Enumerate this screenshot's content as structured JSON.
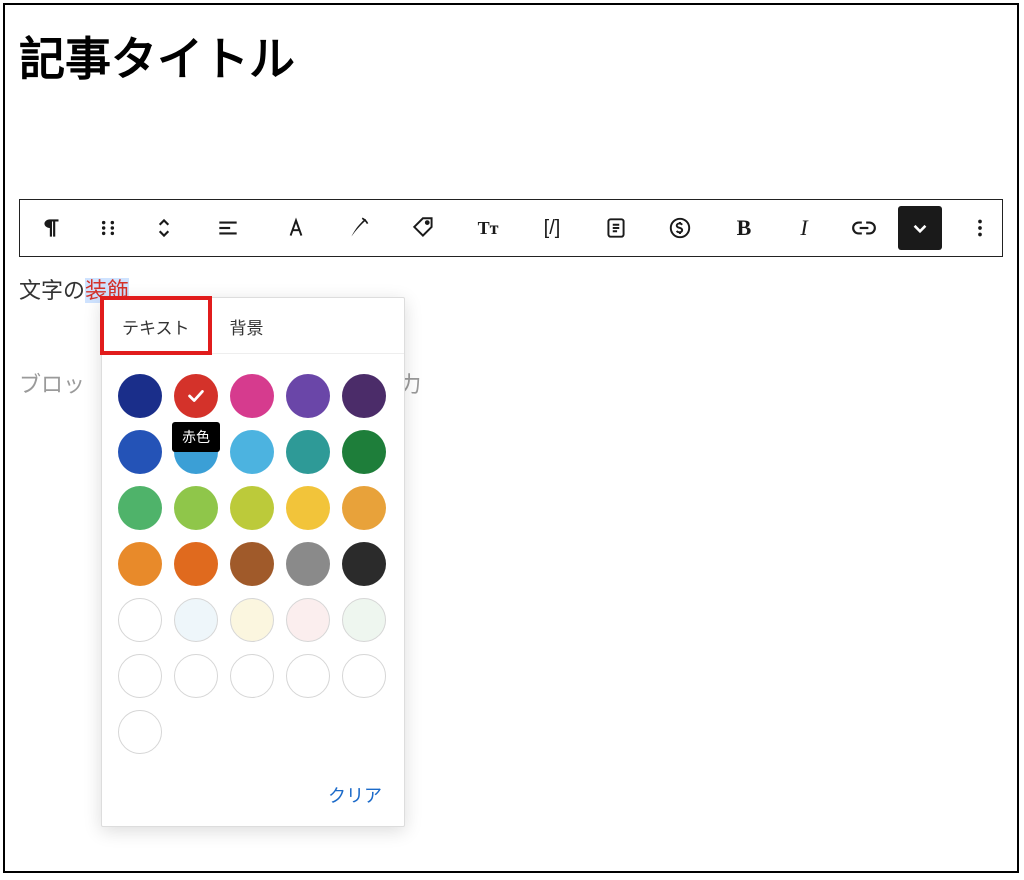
{
  "title": "記事タイトル",
  "toolbar": {
    "bold_glyph": "B",
    "italic_glyph": "I",
    "font_size_glyph": "Tт",
    "shortcode_glyph": "[/]"
  },
  "paragraph": {
    "prefix": "文字の",
    "highlighted": "装飾"
  },
  "placeholder": {
    "left_fragment": "ブロッ",
    "right_fragment": "力"
  },
  "popover": {
    "tab_text": "テキスト",
    "tab_background": "背景",
    "tooltip": "赤色",
    "clear": "クリア",
    "swatches": [
      {
        "name": "navy",
        "hex": "#1a2e8a",
        "hollow": false,
        "selected": false,
        "tooltip": false
      },
      {
        "name": "red",
        "hex": "#d4322a",
        "hollow": false,
        "selected": true,
        "tooltip": true
      },
      {
        "name": "pink",
        "hex": "#d63b8e",
        "hollow": false,
        "selected": false,
        "tooltip": false
      },
      {
        "name": "purple",
        "hex": "#6a46a8",
        "hollow": false,
        "selected": false,
        "tooltip": false
      },
      {
        "name": "dark-purple",
        "hex": "#4b2c69",
        "hollow": false,
        "selected": false,
        "tooltip": false
      },
      {
        "name": "blue",
        "hex": "#2453b7",
        "hollow": false,
        "selected": false,
        "tooltip": false
      },
      {
        "name": "sky",
        "hex": "#3b9fd6",
        "hollow": false,
        "selected": false,
        "tooltip": false
      },
      {
        "name": "light-blue",
        "hex": "#4cb3e0",
        "hollow": false,
        "selected": false,
        "tooltip": false
      },
      {
        "name": "teal",
        "hex": "#2e9a97",
        "hollow": false,
        "selected": false,
        "tooltip": false
      },
      {
        "name": "dark-green",
        "hex": "#1e7e3a",
        "hollow": false,
        "selected": false,
        "tooltip": false
      },
      {
        "name": "green",
        "hex": "#4fb36a",
        "hollow": false,
        "selected": false,
        "tooltip": false
      },
      {
        "name": "lime",
        "hex": "#8fc64a",
        "hollow": false,
        "selected": false,
        "tooltip": false
      },
      {
        "name": "yellow-green",
        "hex": "#bcca3a",
        "hollow": false,
        "selected": false,
        "tooltip": false
      },
      {
        "name": "yellow",
        "hex": "#f2c43a",
        "hollow": false,
        "selected": false,
        "tooltip": false
      },
      {
        "name": "gold",
        "hex": "#e8a23a",
        "hollow": false,
        "selected": false,
        "tooltip": false
      },
      {
        "name": "orange",
        "hex": "#e88a2a",
        "hollow": false,
        "selected": false,
        "tooltip": false
      },
      {
        "name": "dark-orange",
        "hex": "#e06a1e",
        "hollow": false,
        "selected": false,
        "tooltip": false
      },
      {
        "name": "brown",
        "hex": "#a05a2a",
        "hollow": false,
        "selected": false,
        "tooltip": false
      },
      {
        "name": "gray",
        "hex": "#8a8a8a",
        "hollow": false,
        "selected": false,
        "tooltip": false
      },
      {
        "name": "black",
        "hex": "#2b2b2b",
        "hollow": false,
        "selected": false,
        "tooltip": false
      },
      {
        "name": "white",
        "hex": "#ffffff",
        "hollow": true,
        "selected": false,
        "tooltip": false
      },
      {
        "name": "pale-blue",
        "hex": "#eef6fa",
        "hollow": true,
        "selected": false,
        "tooltip": false
      },
      {
        "name": "pale-yellow",
        "hex": "#fbf6df",
        "hollow": true,
        "selected": false,
        "tooltip": false
      },
      {
        "name": "pale-pink",
        "hex": "#fbeeee",
        "hollow": true,
        "selected": false,
        "tooltip": false
      },
      {
        "name": "pale-green",
        "hex": "#eef6ef",
        "hollow": true,
        "selected": false,
        "tooltip": false
      },
      {
        "name": "empty-1",
        "hex": "#ffffff",
        "hollow": true,
        "selected": false,
        "tooltip": false
      },
      {
        "name": "empty-2",
        "hex": "#ffffff",
        "hollow": true,
        "selected": false,
        "tooltip": false
      },
      {
        "name": "empty-3",
        "hex": "#ffffff",
        "hollow": true,
        "selected": false,
        "tooltip": false
      },
      {
        "name": "empty-4",
        "hex": "#ffffff",
        "hollow": true,
        "selected": false,
        "tooltip": false
      },
      {
        "name": "empty-5",
        "hex": "#ffffff",
        "hollow": true,
        "selected": false,
        "tooltip": false
      },
      {
        "name": "empty-6",
        "hex": "#ffffff",
        "hollow": true,
        "selected": false,
        "tooltip": false
      }
    ]
  }
}
